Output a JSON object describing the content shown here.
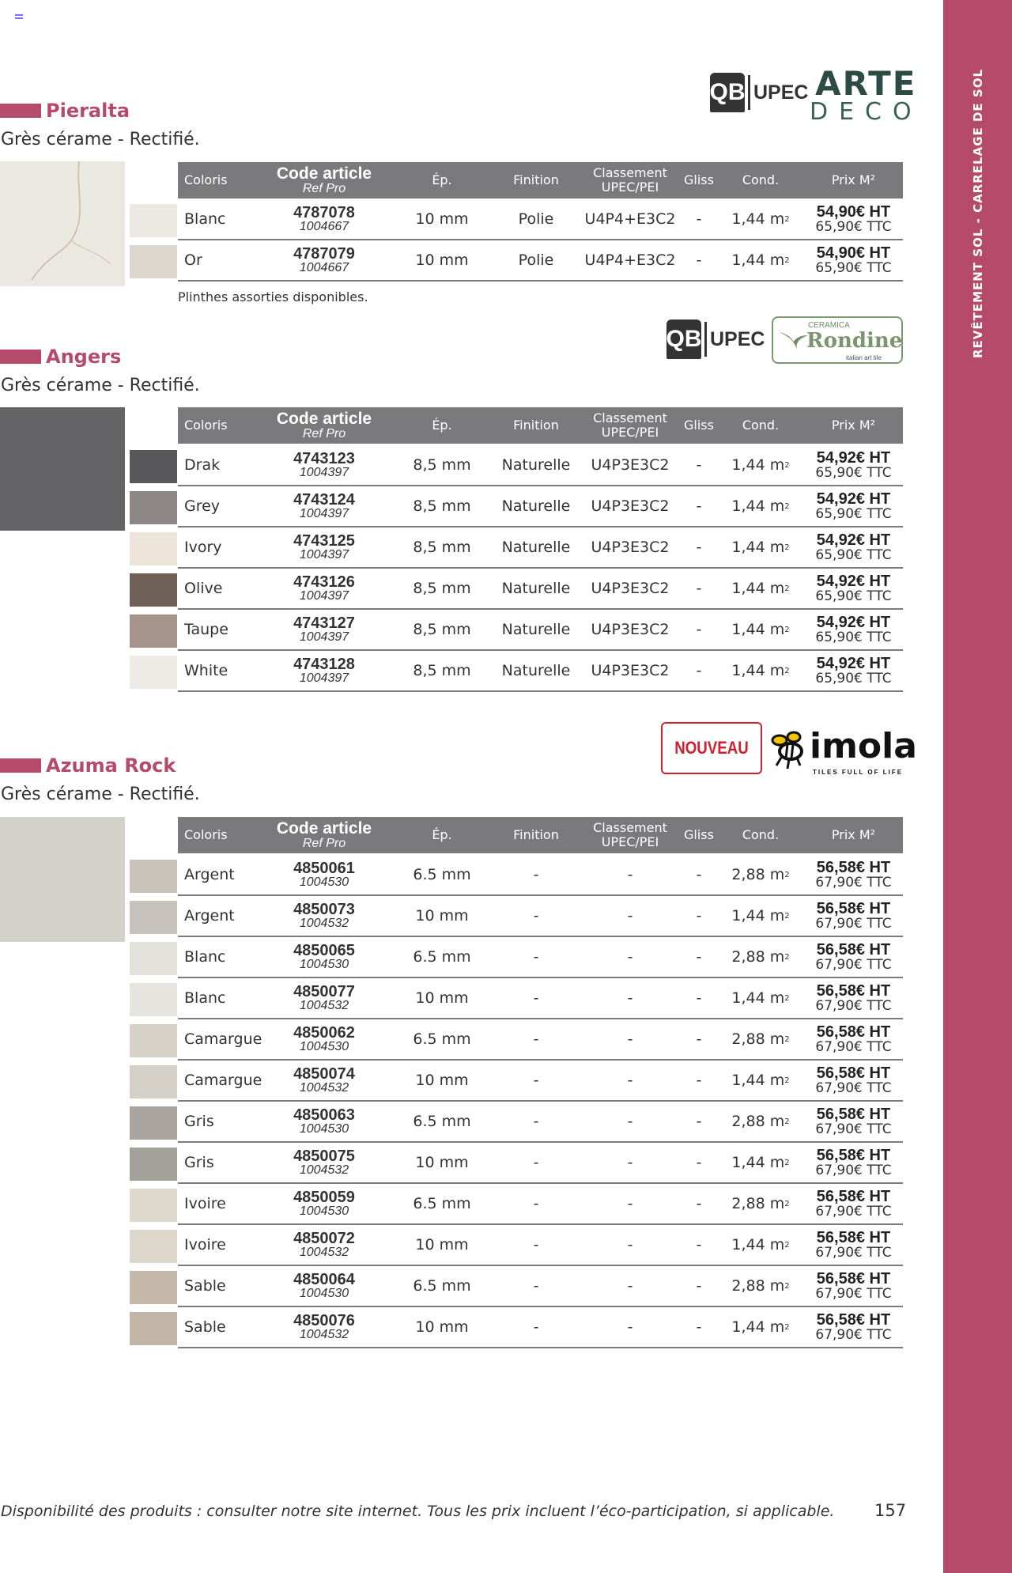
{
  "side_label": "REVÊTEMENT SOL - CARRELAGE DE SOL",
  "headers": {
    "coloris": "Coloris",
    "code": "Code article",
    "ref": "Ref Pro",
    "ep": "Ép.",
    "finition": "Finition",
    "classement1": "Classement",
    "classement2": "UPEC/PEI",
    "gliss": "Gliss",
    "cond": "Cond.",
    "prix": "Prix M²"
  },
  "logos": {
    "qb": "QB",
    "upec": "UPEC",
    "arte_1": "ARTE",
    "arte_2": "DECO",
    "rondine_small": "CERAMICA",
    "rondine_big": "Rondine",
    "rondine_tag": "italian art tile",
    "nouveau": "NOUVEAU",
    "imola": "imola",
    "imola_tag": "TILES FULL OF LIFE"
  },
  "sections": [
    {
      "name": "Pieralta",
      "subtitle": "Grès cérame - Rectifié.",
      "note": "Plinthes assorties disponibles.",
      "rows": [
        {
          "color": "Blanc",
          "code": "4787078",
          "ref": "1004667",
          "ep": "10 mm",
          "finition": "Polie",
          "classement": "U4P4+E3C2",
          "gliss": "-",
          "cond": "1,44 m",
          "ht": "54,90€ HT",
          "ttc": "65,90€ TTC",
          "swatch": "#ece9e2"
        },
        {
          "color": "Or",
          "code": "4787079",
          "ref": "1004667",
          "ep": "10 mm",
          "finition": "Polie",
          "classement": "U4P4+E3C2",
          "gliss": "-",
          "cond": "1,44 m",
          "ht": "54,90€ HT",
          "ttc": "65,90€ TTC",
          "swatch": "#dcd6cc"
        }
      ]
    },
    {
      "name": "Angers",
      "subtitle": "Grès cérame - Rectifié.",
      "rows": [
        {
          "color": "Drak",
          "code": "4743123",
          "ref": "1004397",
          "ep": "8,5 mm",
          "finition": "Naturelle",
          "classement": "U4P3E3C2",
          "gliss": "-",
          "cond": "1,44 m",
          "ht": "54,92€ HT",
          "ttc": "65,90€ TTC",
          "swatch": "#58585a"
        },
        {
          "color": "Grey",
          "code": "4743124",
          "ref": "1004397",
          "ep": "8,5 mm",
          "finition": "Naturelle",
          "classement": "U4P3E3C2",
          "gliss": "-",
          "cond": "1,44 m",
          "ht": "54,92€ HT",
          "ttc": "65,90€ TTC",
          "swatch": "#8d8787"
        },
        {
          "color": "Ivory",
          "code": "4743125",
          "ref": "1004397",
          "ep": "8,5 mm",
          "finition": "Naturelle",
          "classement": "U4P3E3C2",
          "gliss": "-",
          "cond": "1,44 m",
          "ht": "54,92€ HT",
          "ttc": "65,90€ TTC",
          "swatch": "#ece3d9"
        },
        {
          "color": "Olive",
          "code": "4743126",
          "ref": "1004397",
          "ep": "8,5 mm",
          "finition": "Naturelle",
          "classement": "U4P3E3C2",
          "gliss": "-",
          "cond": "1,44 m",
          "ht": "54,92€ HT",
          "ttc": "65,90€ TTC",
          "swatch": "#6f6058"
        },
        {
          "color": "Taupe",
          "code": "4743127",
          "ref": "1004397",
          "ep": "8,5 mm",
          "finition": "Naturelle",
          "classement": "U4P3E3C2",
          "gliss": "-",
          "cond": "1,44 m",
          "ht": "54,92€ HT",
          "ttc": "65,90€ TTC",
          "swatch": "#a5958d"
        },
        {
          "color": "White",
          "code": "4743128",
          "ref": "1004397",
          "ep": "8,5 mm",
          "finition": "Naturelle",
          "classement": "U4P3E3C2",
          "gliss": "-",
          "cond": "1,44 m",
          "ht": "54,92€ HT",
          "ttc": "65,90€ TTC",
          "swatch": "#eeebe7"
        }
      ]
    },
    {
      "name": "Azuma Rock",
      "subtitle": "Grès cérame - Rectifié.",
      "rows": [
        {
          "color": "Argent",
          "code": "4850061",
          "ref": "1004530",
          "ep": "6.5 mm",
          "finition": "-",
          "classement": "-",
          "gliss": "-",
          "cond": "2,88 m",
          "ht": "56,58€ HT",
          "ttc": "67,90€ TTC",
          "swatch": "#c9c3bc"
        },
        {
          "color": "Argent",
          "code": "4850073",
          "ref": "1004532",
          "ep": "10 mm",
          "finition": "-",
          "classement": "-",
          "gliss": "-",
          "cond": "1,44 m",
          "ht": "56,58€ HT",
          "ttc": "67,90€ TTC",
          "swatch": "#c6c1ba"
        },
        {
          "color": "Blanc",
          "code": "4850065",
          "ref": "1004530",
          "ep": "6.5 mm",
          "finition": "-",
          "classement": "-",
          "gliss": "-",
          "cond": "2,88 m",
          "ht": "56,58€ HT",
          "ttc": "67,90€ TTC",
          "swatch": "#e3e1dc"
        },
        {
          "color": "Blanc",
          "code": "4850077",
          "ref": "1004532",
          "ep": "10 mm",
          "finition": "-",
          "classement": "-",
          "gliss": "-",
          "cond": "1,44 m",
          "ht": "56,58€ HT",
          "ttc": "67,90€ TTC",
          "swatch": "#e6e4df"
        },
        {
          "color": "Camargue",
          "code": "4850062",
          "ref": "1004530",
          "ep": "6.5 mm",
          "finition": "-",
          "classement": "-",
          "gliss": "-",
          "cond": "2,88 m",
          "ht": "56,58€ HT",
          "ttc": "67,90€ TTC",
          "swatch": "#d7d2ca"
        },
        {
          "color": "Camargue",
          "code": "4850074",
          "ref": "1004532",
          "ep": "10 mm",
          "finition": "-",
          "classement": "-",
          "gliss": "-",
          "cond": "1,44 m",
          "ht": "56,58€ HT",
          "ttc": "67,90€ TTC",
          "swatch": "#d4cfc7"
        },
        {
          "color": "Gris",
          "code": "4850063",
          "ref": "1004530",
          "ep": "6.5 mm",
          "finition": "-",
          "classement": "-",
          "gliss": "-",
          "cond": "2,88 m",
          "ht": "56,58€ HT",
          "ttc": "67,90€ TTC",
          "swatch": "#a9a49e"
        },
        {
          "color": "Gris",
          "code": "4850075",
          "ref": "1004532",
          "ep": "10 mm",
          "finition": "-",
          "classement": "-",
          "gliss": "-",
          "cond": "1,44 m",
          "ht": "56,58€ HT",
          "ttc": "67,90€ TTC",
          "swatch": "#a4a09a"
        },
        {
          "color": "Ivoire",
          "code": "4850059",
          "ref": "1004530",
          "ep": "6.5 mm",
          "finition": "-",
          "classement": "-",
          "gliss": "-",
          "cond": "2,88 m",
          "ht": "56,58€ HT",
          "ttc": "67,90€ TTC",
          "swatch": "#dfd8cd"
        },
        {
          "color": "Ivoire",
          "code": "4850072",
          "ref": "1004532",
          "ep": "10 mm",
          "finition": "-",
          "classement": "-",
          "gliss": "-",
          "cond": "1,44 m",
          "ht": "56,58€ HT",
          "ttc": "67,90€ TTC",
          "swatch": "#ddd6cb"
        },
        {
          "color": "Sable",
          "code": "4850064",
          "ref": "1004530",
          "ep": "6.5 mm",
          "finition": "-",
          "classement": "-",
          "gliss": "-",
          "cond": "2,88 m",
          "ht": "56,58€ HT",
          "ttc": "67,90€ TTC",
          "swatch": "#c4b8aa"
        },
        {
          "color": "Sable",
          "code": "4850076",
          "ref": "1004532",
          "ep": "10 mm",
          "finition": "-",
          "classement": "-",
          "gliss": "-",
          "cond": "1,44 m",
          "ht": "56,58€ HT",
          "ttc": "67,90€ TTC",
          "swatch": "#c2b6a8"
        }
      ]
    }
  ],
  "footer": "Disponibilité des produits : consulter notre site internet. Tous les prix incluent l’éco-participation, si applicable.",
  "page_number": "157"
}
